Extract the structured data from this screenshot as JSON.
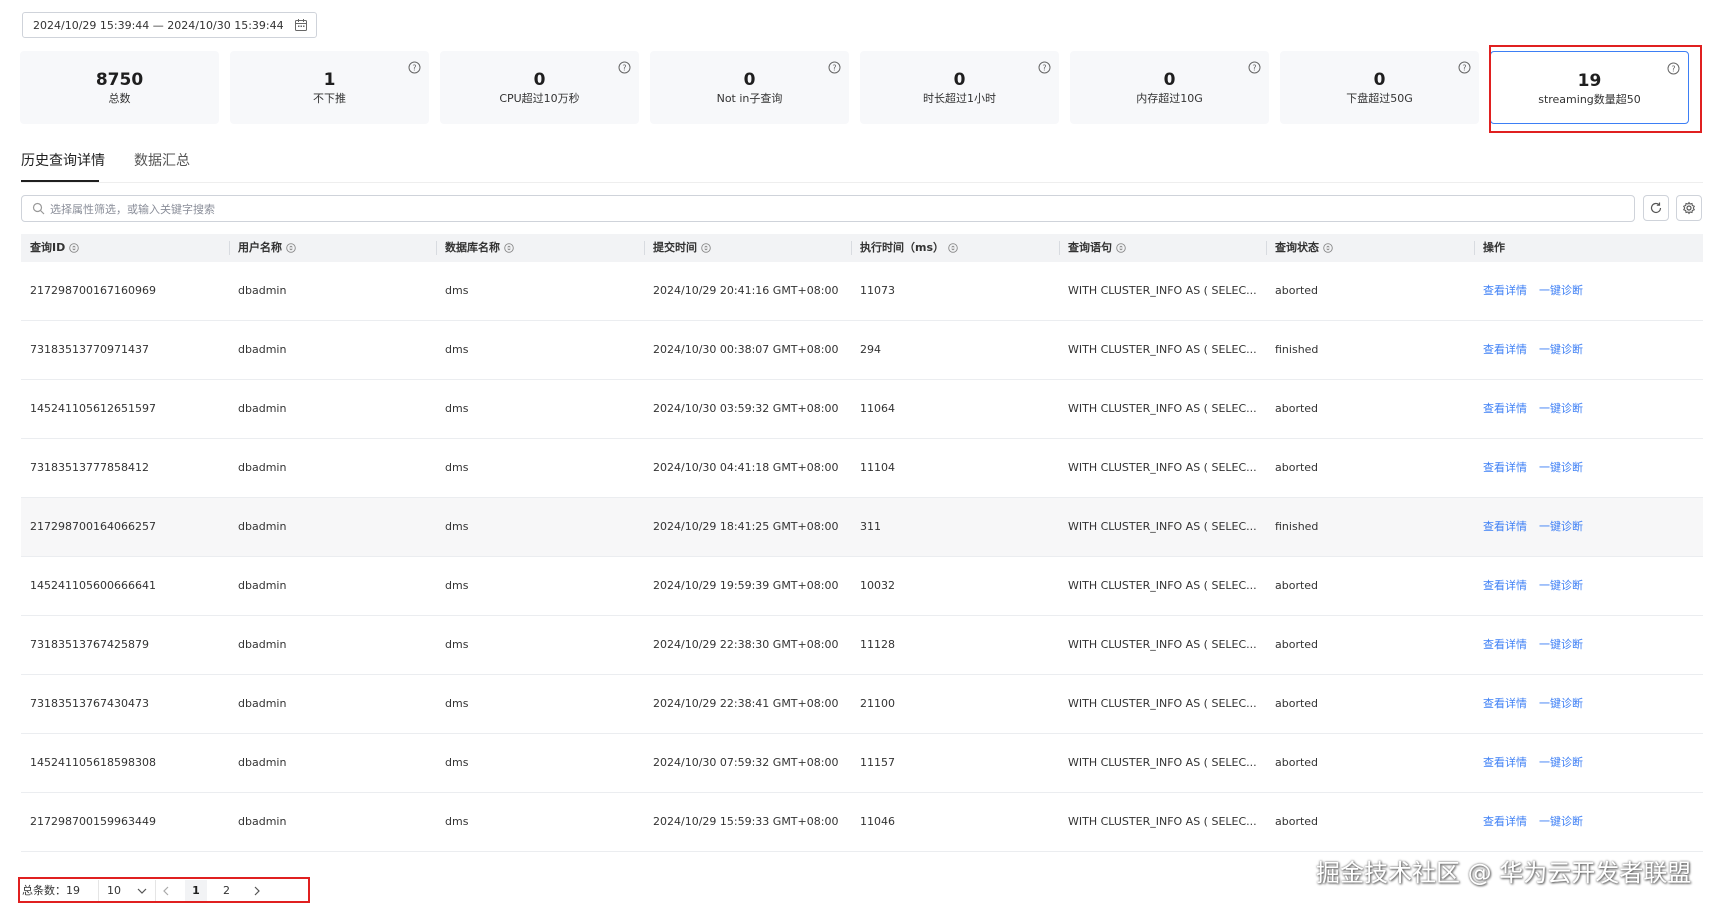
{
  "filters": {
    "date_range": "2024/10/29 15:39:44 — 2024/10/30 15:39:44",
    "calendar_icon": "calendar-icon"
  },
  "stats": [
    {
      "value": "8750",
      "label": "总数",
      "has_help": false
    },
    {
      "value": "1",
      "label": "不下推",
      "has_help": true
    },
    {
      "value": "0",
      "label": "CPU超过10万秒",
      "has_help": true
    },
    {
      "value": "0",
      "label": "Not in子查询",
      "has_help": true
    },
    {
      "value": "0",
      "label": "时长超过1小时",
      "has_help": true
    },
    {
      "value": "0",
      "label": "内存超过10G",
      "has_help": true
    },
    {
      "value": "0",
      "label": "下盘超过50G",
      "has_help": true
    },
    {
      "value": "19",
      "label": "streaming数量超50",
      "has_help": true
    }
  ],
  "tabs": [
    {
      "label": "历史查询详情",
      "active": true
    },
    {
      "label": "数据汇总",
      "active": false
    }
  ],
  "search": {
    "placeholder": "选择属性筛选，或输入关键字搜索"
  },
  "table": {
    "columns": [
      "查询ID",
      "用户名称",
      "数据库名称",
      "提交时间",
      "执行时间（ms）",
      "查询语句",
      "查询状态",
      "操作"
    ],
    "rows": [
      {
        "id": "217298700167160969",
        "user": "dbadmin",
        "db": "dms",
        "submit": "2024/10/29 20:41:16 GMT+08:00",
        "exec": "11073",
        "sql": "WITH CLUSTER_INFO AS ( SELEC...",
        "status": "aborted"
      },
      {
        "id": "73183513770971437",
        "user": "dbadmin",
        "db": "dms",
        "submit": "2024/10/30 00:38:07 GMT+08:00",
        "exec": "294",
        "sql": "WITH CLUSTER_INFO AS ( SELEC...",
        "status": "finished"
      },
      {
        "id": "145241105612651597",
        "user": "dbadmin",
        "db": "dms",
        "submit": "2024/10/30 03:59:32 GMT+08:00",
        "exec": "11064",
        "sql": "WITH CLUSTER_INFO AS ( SELEC...",
        "status": "aborted"
      },
      {
        "id": "73183513777858412",
        "user": "dbadmin",
        "db": "dms",
        "submit": "2024/10/30 04:41:18 GMT+08:00",
        "exec": "11104",
        "sql": "WITH CLUSTER_INFO AS ( SELEC...",
        "status": "aborted"
      },
      {
        "id": "217298700164066257",
        "user": "dbadmin",
        "db": "dms",
        "submit": "2024/10/29 18:41:25 GMT+08:00",
        "exec": "311",
        "sql": "WITH CLUSTER_INFO AS ( SELEC...",
        "status": "finished"
      },
      {
        "id": "145241105600666641",
        "user": "dbadmin",
        "db": "dms",
        "submit": "2024/10/29 19:59:39 GMT+08:00",
        "exec": "10032",
        "sql": "WITH CLUSTER_INFO AS ( SELEC...",
        "status": "aborted"
      },
      {
        "id": "73183513767425879",
        "user": "dbadmin",
        "db": "dms",
        "submit": "2024/10/29 22:38:30 GMT+08:00",
        "exec": "11128",
        "sql": "WITH CLUSTER_INFO AS ( SELEC...",
        "status": "aborted"
      },
      {
        "id": "73183513767430473",
        "user": "dbadmin",
        "db": "dms",
        "submit": "2024/10/29 22:38:41 GMT+08:00",
        "exec": "21100",
        "sql": "WITH CLUSTER_INFO AS ( SELEC...",
        "status": "aborted"
      },
      {
        "id": "145241105618598308",
        "user": "dbadmin",
        "db": "dms",
        "submit": "2024/10/30 07:59:32 GMT+08:00",
        "exec": "11157",
        "sql": "WITH CLUSTER_INFO AS ( SELEC...",
        "status": "aborted"
      },
      {
        "id": "217298700159963449",
        "user": "dbadmin",
        "db": "dms",
        "submit": "2024/10/29 15:59:33 GMT+08:00",
        "exec": "11046",
        "sql": "WITH CLUSTER_INFO AS ( SELEC...",
        "status": "aborted"
      }
    ],
    "action_view": "查看详情",
    "action_diagnose": "一键诊断"
  },
  "pagination": {
    "total_label": "总条数：19",
    "page_size": "10",
    "pages": [
      "1",
      "2"
    ],
    "current_page": "1"
  },
  "watermark": "掘金技术社区 @ 华为云开发者联盟",
  "colors": {
    "link": "#3d7ff5",
    "highlight": "#e02020",
    "header_bg": "#f2f3f5"
  }
}
